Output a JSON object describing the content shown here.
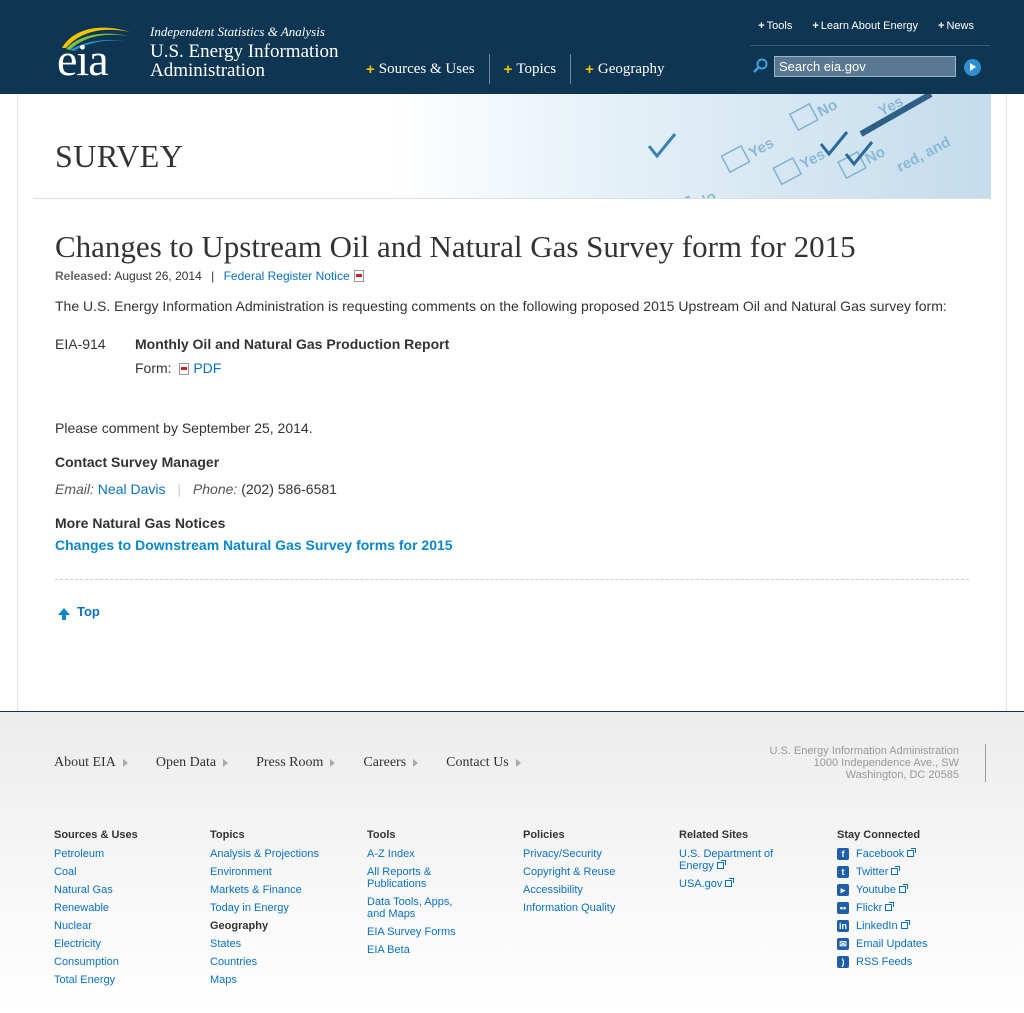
{
  "header": {
    "logo_text": "eia",
    "tagline": "Independent Statistics & Analysis",
    "org_name": "U.S. Energy Information Administration",
    "nav": [
      "Sources & Uses",
      "Topics",
      "Geography"
    ],
    "top_links": [
      "Tools",
      "Learn About Energy",
      "News"
    ],
    "search": {
      "placeholder": "Search eia.gov"
    }
  },
  "banner": {
    "title": "SURVEY",
    "image_words": [
      "No",
      "Yes",
      "No",
      "Yes",
      "No",
      "No",
      "Yes",
      "No",
      "red, and"
    ]
  },
  "main": {
    "title": "Changes to Upstream Oil and Natural Gas Survey form for 2015",
    "released_label": "Released:",
    "released_date": "August 26, 2014",
    "separator": "|",
    "register_link": "Federal Register Notice",
    "intro": "The U.S. Energy Information Administration is requesting comments on the following proposed 2015 Upstream Oil and Natural Gas survey form:",
    "form": {
      "id": "EIA-914",
      "title": "Monthly Oil and Natural Gas Production Report",
      "form_label": "Form:",
      "pdf_link": "PDF"
    },
    "comment": "Please comment by September 25, 2014.",
    "contact_heading": "Contact Survey Manager",
    "email_label": "Email:",
    "email_name": "Neal Davis",
    "phone_label": "Phone:",
    "phone": "(202) 586-6581",
    "more_heading": "More Natural Gas Notices",
    "more_link": "Changes to Downstream Natural Gas Survey forms for 2015",
    "top_link": "Top"
  },
  "footer": {
    "nav": [
      "About EIA",
      "Open Data",
      "Press Room",
      "Careers",
      "Contact Us"
    ],
    "address": [
      "U.S. Energy Information Administration",
      "1000 Independence Ave., SW",
      "Washington, DC 20585"
    ],
    "columns": {
      "sources": {
        "head": "Sources & Uses",
        "links": [
          "Petroleum",
          "Coal",
          "Natural Gas",
          "Renewable",
          "Nuclear",
          "Electricity",
          "Consumption",
          "Total Energy"
        ]
      },
      "topics": {
        "head": "Topics",
        "links": [
          "Analysis & Projections",
          "Environment",
          "Markets & Finance",
          "Today in Energy"
        ],
        "sub_head": "Geography",
        "sub_links": [
          "States",
          "Countries",
          "Maps"
        ]
      },
      "tools": {
        "head": "Tools",
        "links": [
          "A-Z Index",
          "All Reports & Publications",
          "Data Tools, Apps, and Maps",
          "EIA Survey Forms",
          "EIA Beta"
        ]
      },
      "policies": {
        "head": "Policies",
        "links": [
          "Privacy/Security",
          "Copyright & Reuse",
          "Accessibility",
          "Information Quality"
        ]
      },
      "related": {
        "head": "Related Sites",
        "links": [
          "U.S. Department of Energy",
          "USA.gov"
        ]
      },
      "social": {
        "head": "Stay Connected",
        "links": [
          "Facebook",
          "Twitter",
          "Youtube",
          "Flickr",
          "LinkedIn",
          "Email Updates",
          "RSS Feeds"
        ]
      }
    }
  }
}
